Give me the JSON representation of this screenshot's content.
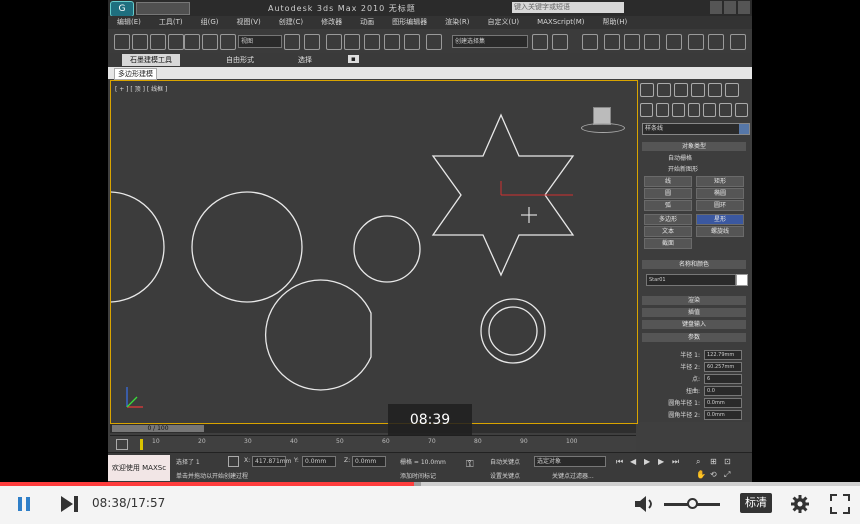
{
  "app": {
    "title": "Autodesk 3ds Max  2010    无标题",
    "search_placeholder": "键入关键字或短语",
    "logo_text": "G"
  },
  "menu": [
    "编辑(E)",
    "工具(T)",
    "组(G)",
    "视图(V)",
    "创建(C)",
    "修改器",
    "动画",
    "图形编辑器",
    "渲染(R)",
    "自定义(U)",
    "MAXScript(M)",
    "帮助(H)"
  ],
  "toolbar": {
    "selection_filter": "全部",
    "view_dropdown": "视图",
    "named_selection": "创建选择集"
  },
  "ribbon": {
    "tabs": [
      "石墨建模工具",
      "自由形式",
      "选择"
    ],
    "active_tab": 0,
    "sub_button": "多边形建模"
  },
  "viewport": {
    "label": "[ + ] [ 顶 ] [ 线框 ]",
    "scroll_label": "0 / 100",
    "timeline_ticks": [
      "10",
      "20",
      "30",
      "40",
      "50",
      "60",
      "70",
      "80",
      "90",
      "100"
    ]
  },
  "command_panel": {
    "category_dropdown": "样条线",
    "rollout_object_type": "对象类型",
    "auto_grid": "自动栅格",
    "start_new_shape": "开始新图形",
    "buttons": [
      [
        "线",
        "矩形"
      ],
      [
        "圆",
        "椭圆"
      ],
      [
        "弧",
        "圆环"
      ],
      [
        "多边形",
        "星形"
      ],
      [
        "文本",
        "螺旋线"
      ],
      [
        "截面",
        ""
      ]
    ],
    "active_button": "星形",
    "rollout_name_color": "名称和颜色",
    "object_name": "Star01",
    "rollout_render": "渲染",
    "rollout_interp": "插值",
    "rollout_keyboard": "键盘输入",
    "rollout_params": "参数",
    "params": [
      {
        "label": "半径 1:",
        "value": "122.79mm"
      },
      {
        "label": "半径 2:",
        "value": "60.257mm"
      },
      {
        "label": "点:",
        "value": "6"
      },
      {
        "label": "扭曲:",
        "value": "0.0"
      },
      {
        "label": "圆角半径 1:",
        "value": "0.0mm"
      },
      {
        "label": "圆角半径 2:",
        "value": "0.0mm"
      }
    ]
  },
  "status": {
    "welcome": "欢迎使用 MAXSc",
    "selected": "选择了 1",
    "prompt": "单击并拖动以开始创建过程",
    "x_label": "X:",
    "x_value": "417.871mm",
    "y_label": "Y:",
    "y_value": "0.0mm",
    "z_label": "Z:",
    "z_value": "0.0mm",
    "grid": "栅格 = 10.0mm",
    "add_time_tag": "添加时间标记",
    "auto_key": "自动关键点",
    "set_key": "设置关键点",
    "selected_object": "选定对象",
    "key_filters": "关键点过滤器..."
  },
  "player": {
    "time_display": "08:38/17:57",
    "tooltip_time": "08:39",
    "quality": "标清",
    "progress": 0.481,
    "buffered": 0.49,
    "volume": 0.5,
    "accent": "#ff3d3d"
  }
}
